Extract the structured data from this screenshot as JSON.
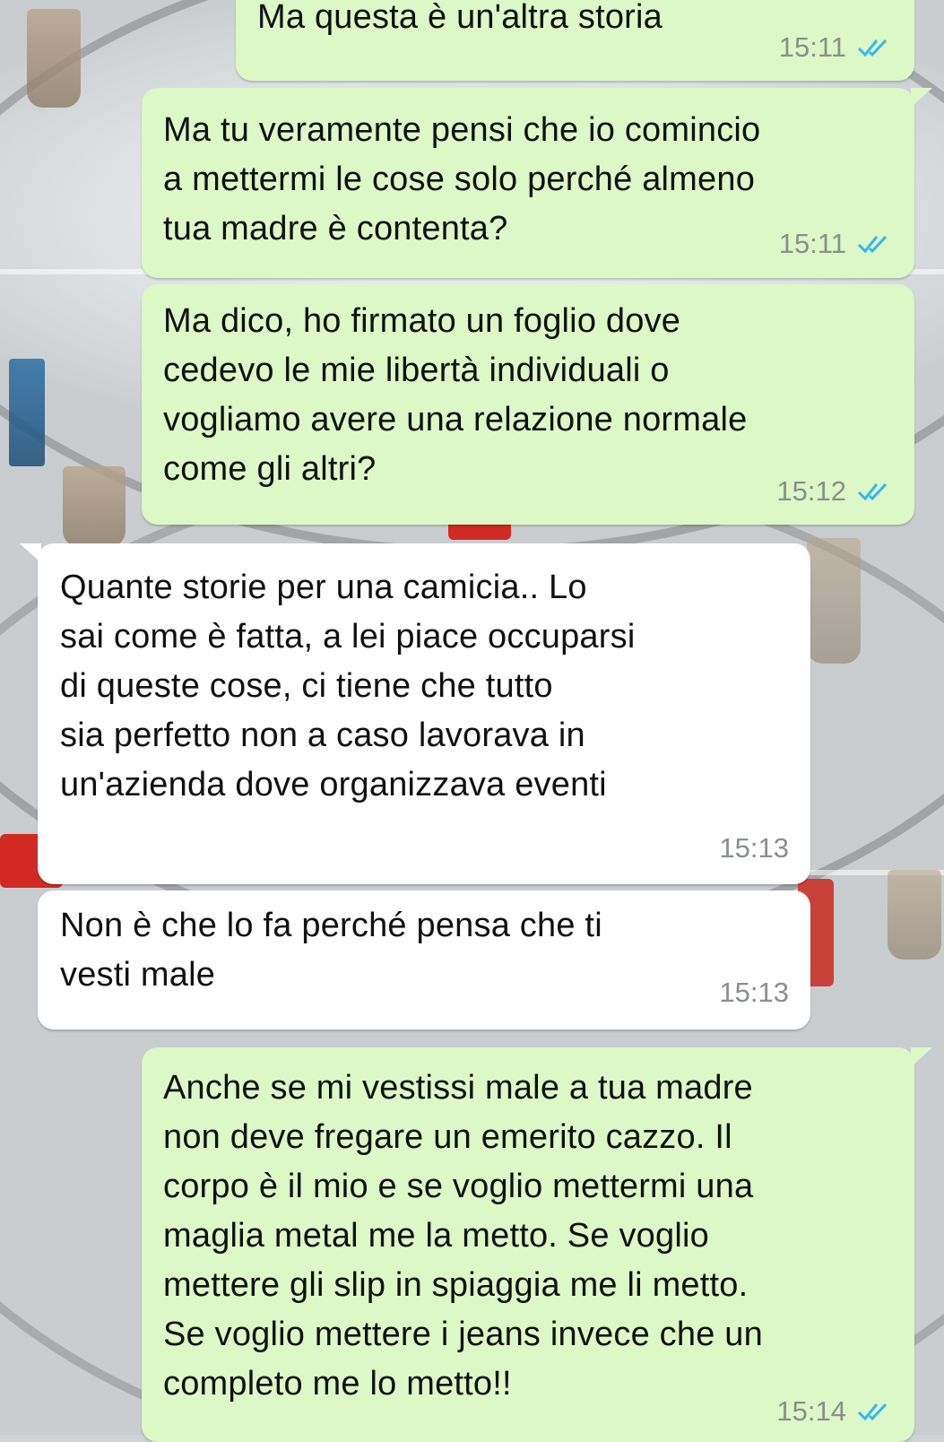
{
  "messages": [
    {
      "direction": "outgoing",
      "text": "Ma questa è un'altra storia",
      "time": "15:11",
      "status": "read"
    },
    {
      "direction": "outgoing",
      "text": "Ma tu veramente pensi che io comincio\na mettermi le cose solo perché almeno\ntua madre è contenta?",
      "time": "15:11",
      "status": "read"
    },
    {
      "direction": "outgoing",
      "text": "Ma dico, ho firmato un foglio dove\ncedevo le mie libertà individuali o\nvogliamo avere una relazione normale\ncome gli altri?",
      "time": "15:12",
      "status": "read"
    },
    {
      "direction": "incoming",
      "text": "Quante storie per una camicia.. Lo\nsai come è fatta, a lei piace occuparsi\ndi queste cose, ci tiene che tutto\nsia perfetto non a caso lavorava in\nun'azienda dove organizzava eventi",
      "time": "15:13"
    },
    {
      "direction": "incoming",
      "text": "Non è che lo fa perché pensa che ti\nvesti male",
      "time": "15:13"
    },
    {
      "direction": "outgoing",
      "text": "Anche se mi vestissi male a tua madre\nnon deve fregare un emerito cazzo. Il\ncorpo è il mio e se voglio mettermi una\nmaglia metal me la metto. Se voglio\nmettere gli slip in spiaggia me li metto.\nSe voglio mettere i jeans invece che un\ncompleto me lo metto!!",
      "time": "15:14",
      "status": "read"
    }
  ],
  "colors": {
    "outgoing_bubble": "#dcf8c6",
    "incoming_bubble": "#ffffff",
    "read_ticks": "#34b7f1",
    "timestamp": "#8a8f8c"
  },
  "icons": {
    "read_receipt": "double-check-icon"
  }
}
